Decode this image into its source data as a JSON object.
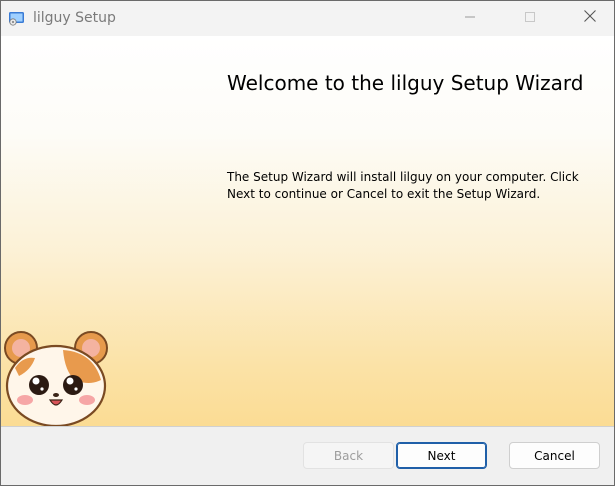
{
  "window": {
    "title": "lilguy Setup",
    "app_icon": "setup-installer-icon"
  },
  "caption_buttons": {
    "minimize_icon": "minimize-icon",
    "maximize_icon": "maximize-icon",
    "close_icon": "close-icon"
  },
  "content": {
    "heading": "Welcome to the lilguy Setup Wizard",
    "body": "The Setup Wizard will install lilguy on your computer. Click Next to continue or Cancel to exit the Setup Wizard.",
    "mascot": "hamster-mascot-image"
  },
  "footer": {
    "back_label": "Back",
    "back_enabled": false,
    "next_label": "Next",
    "cancel_label": "Cancel"
  },
  "colors": {
    "gradient_top": "#ffffff",
    "gradient_bottom": "#fbdc94",
    "default_button_border": "#1f5fa8"
  }
}
